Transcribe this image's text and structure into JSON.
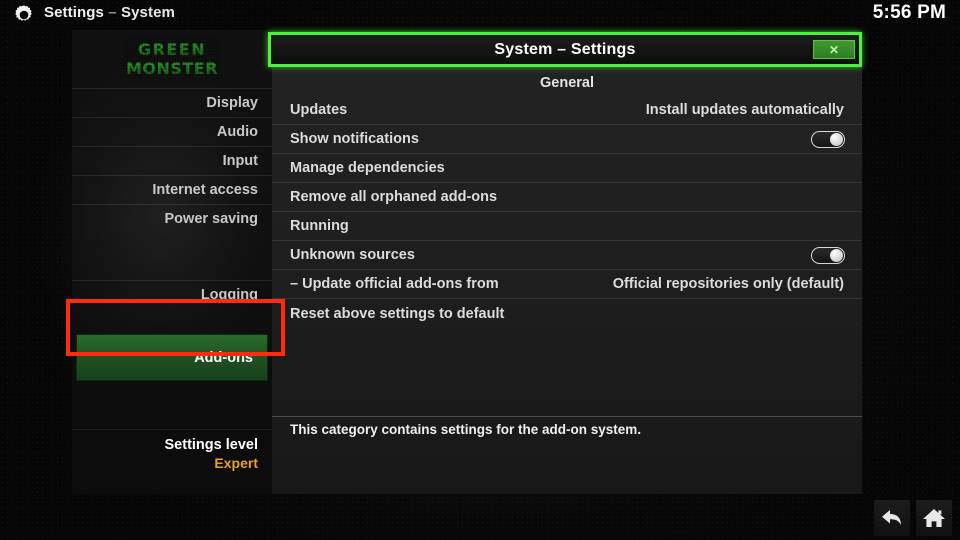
{
  "topbar": {
    "gear_icon": "gear-icon",
    "app_title": "Settings",
    "title_separator": "–",
    "app_subtitle": "System",
    "clock": "5:56 PM"
  },
  "dialog": {
    "title": "System – Settings",
    "close_label": "✕"
  },
  "sidebar": {
    "logo_line1": "GREEN",
    "logo_line2": "MONSTER",
    "items": [
      {
        "label": "Display",
        "selected": false
      },
      {
        "label": "Audio",
        "selected": false
      },
      {
        "label": "Input",
        "selected": false
      },
      {
        "label": "Internet access",
        "selected": false
      },
      {
        "label": "Power saving",
        "selected": false
      },
      {
        "label": "Add-ons",
        "selected": true
      },
      {
        "label": "Logging",
        "selected": false
      }
    ],
    "selected_item": "Add-ons",
    "settings_level_label": "Settings level",
    "settings_level_value": "Expert"
  },
  "content": {
    "group_header": "General",
    "rows": [
      {
        "label": "Updates",
        "value": "Install updates automatically",
        "control": "value"
      },
      {
        "label": "Show notifications",
        "value": "",
        "control": "toggle",
        "toggle_on": true
      },
      {
        "label": "Manage dependencies",
        "value": "",
        "control": "none"
      },
      {
        "label": "Remove all orphaned add-ons",
        "value": "",
        "control": "none"
      },
      {
        "label": "Running",
        "value": "",
        "control": "none"
      },
      {
        "label": "Unknown sources",
        "value": "",
        "control": "toggle",
        "toggle_on": true
      },
      {
        "label": "– Update official add-ons from",
        "value": "Official repositories only (default)",
        "control": "value"
      },
      {
        "label": "Reset above settings to default",
        "value": "",
        "control": "none"
      }
    ],
    "description": "This category contains settings for the add-on system."
  },
  "nav": {
    "back_icon": "back-arrow-icon",
    "home_icon": "home-icon"
  },
  "annotations": [
    {
      "name": "addons-highlight",
      "color": "#ff2a10",
      "shape": "rectangle",
      "target": "Add-ons"
    },
    {
      "name": "titlebar-highlight",
      "color": "#4ef23c",
      "shape": "rectangle",
      "target": "System – Settings"
    }
  ],
  "colors": {
    "annotation_red": "#ff2a10",
    "annotation_green": "#4ef23c",
    "accent_green": "#2b6a2c",
    "settings_level_orange": "#e8a21c",
    "text_primary": "#ffffff",
    "text_secondary": "#dcdcdc",
    "panel_bg": "#242424",
    "sidebar_bg": "#101010"
  }
}
